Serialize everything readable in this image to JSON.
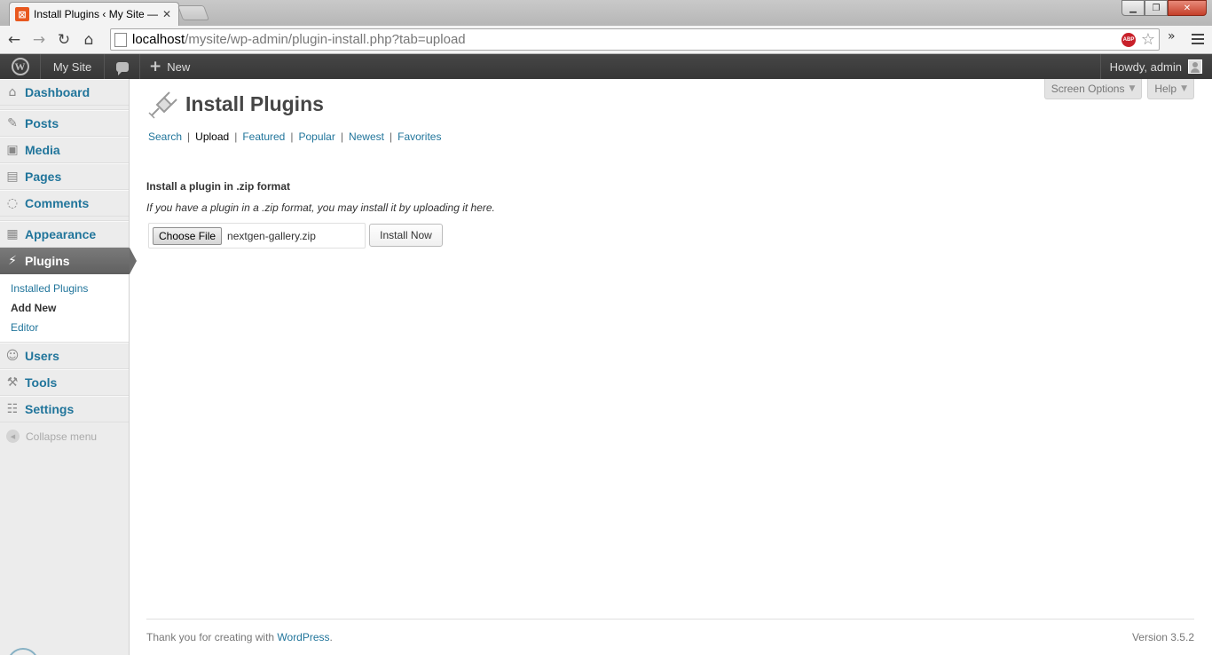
{
  "browser": {
    "tab_title": "Install Plugins ‹ My Site —",
    "tab_close": "✕",
    "url_host": "localhost",
    "url_path": "/mysite/wp-admin/plugin-install.php?tab=upload",
    "abp_label": "ABP",
    "icons": [
      "back-icon",
      "forward-icon",
      "reload-icon",
      "home-icon",
      "star-icon",
      "menu-icon"
    ]
  },
  "adminbar": {
    "site": "My Site",
    "new": "New",
    "howdy": "Howdy, admin"
  },
  "sidebar": {
    "items": [
      {
        "label": "Dashboard",
        "icon": "dashboard-icon"
      },
      {
        "label": "Posts",
        "icon": "pin-icon"
      },
      {
        "label": "Media",
        "icon": "media-icon"
      },
      {
        "label": "Pages",
        "icon": "pages-icon"
      },
      {
        "label": "Comments",
        "icon": "comment-icon"
      },
      {
        "label": "Appearance",
        "icon": "appearance-icon"
      },
      {
        "label": "Plugins",
        "icon": "plug-icon"
      },
      {
        "label": "Users",
        "icon": "users-icon"
      },
      {
        "label": "Tools",
        "icon": "tools-icon"
      },
      {
        "label": "Settings",
        "icon": "settings-icon"
      }
    ],
    "submenu": [
      "Installed Plugins",
      "Add New",
      "Editor"
    ],
    "collapse": "Collapse menu"
  },
  "header": {
    "screen_options": "Screen Options",
    "help": "Help",
    "title": "Install Plugins"
  },
  "subnav": [
    "Search",
    "Upload",
    "Featured",
    "Popular",
    "Newest",
    "Favorites"
  ],
  "upload": {
    "title": "Install a plugin in .zip format",
    "description": "If you have a plugin in a .zip format, you may install it by uploading it here.",
    "choose_file": "Choose File",
    "file_name": "nextgen-gallery.zip",
    "install_now": "Install Now"
  },
  "footer": {
    "thanks": "Thank you for creating with ",
    "link": "WordPress",
    "version": "Version 3.5.2"
  },
  "colors": {
    "link": "#21759b",
    "adminbar": "#464646",
    "active_menu": "#6d6d6d"
  }
}
